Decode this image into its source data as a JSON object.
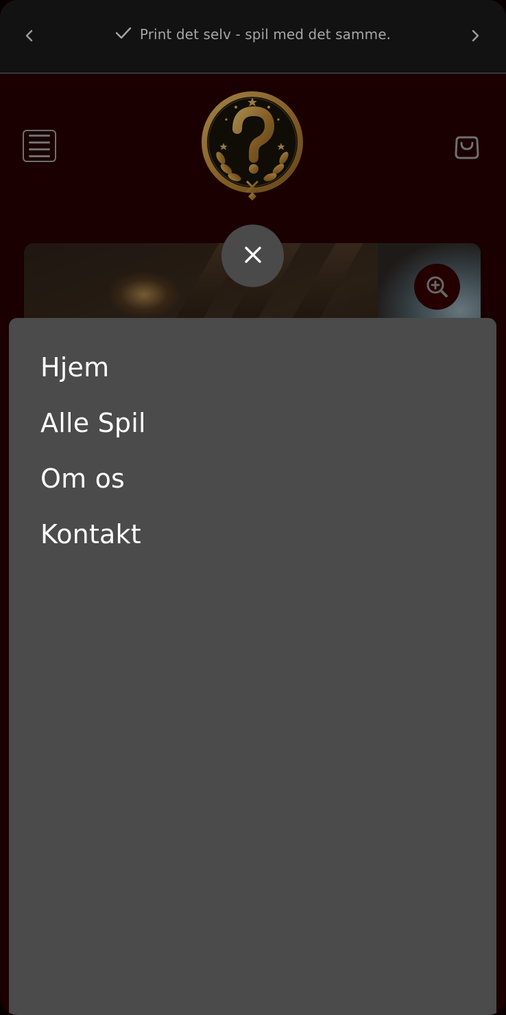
{
  "announcement": {
    "text": "Print det selv - spil med det samme.",
    "prev_icon": "chevron-left-icon",
    "next_icon": "chevron-right-icon",
    "check_icon": "checkmark-icon"
  },
  "header": {
    "menu_icon": "hamburger-menu-icon",
    "logo": "question-mark-laurel-emblem",
    "cart_icon": "shopping-bag-icon"
  },
  "hero": {
    "zoom_icon": "zoom-in-icon"
  },
  "menu": {
    "close_icon": "close-icon",
    "items": [
      {
        "label": "Hjem"
      },
      {
        "label": "Alle Spil"
      },
      {
        "label": "Om os"
      },
      {
        "label": "Kontakt"
      }
    ]
  },
  "colors": {
    "header_bg": "#240000",
    "announcement_bg": "#121212",
    "drawer_bg": "#4b4b4b",
    "close_btn_bg": "#4a4a4a",
    "logo_gold": "#c99a43",
    "zoom_btn_bg": "#330000"
  }
}
